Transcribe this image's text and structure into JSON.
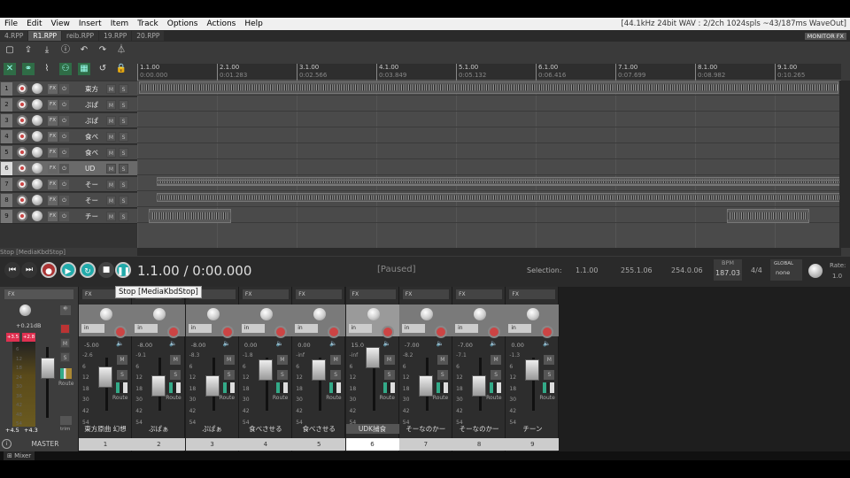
{
  "menu": {
    "items": [
      "File",
      "Edit",
      "View",
      "Insert",
      "Item",
      "Track",
      "Options",
      "Actions",
      "Help"
    ],
    "info": "[44.1kHz 24bit WAV : 2/2ch 1024spls ~43/187ms WaveOut]"
  },
  "tabs": [
    "4.RPP",
    "R1.RPP",
    "reib.RPP",
    "19.RPP",
    "20.RPP"
  ],
  "monitor_fx": "MONITOR FX",
  "tracks": [
    {
      "num": "1",
      "name": "東方",
      "sel": false
    },
    {
      "num": "2",
      "name": "ぷぱ",
      "sel": false
    },
    {
      "num": "3",
      "name": "ぷぱ",
      "sel": false
    },
    {
      "num": "4",
      "name": "食ベ",
      "sel": false
    },
    {
      "num": "5",
      "name": "食ベ",
      "sel": false
    },
    {
      "num": "6",
      "name": "UD",
      "sel": true
    },
    {
      "num": "7",
      "name": "そー",
      "sel": false
    },
    {
      "num": "8",
      "name": "そー",
      "sel": false
    },
    {
      "num": "9",
      "name": "チー",
      "sel": false
    }
  ],
  "ruler": [
    {
      "bar": "1.1.00",
      "time": "0:00.000"
    },
    {
      "bar": "2.1.00",
      "time": "0:01.283"
    },
    {
      "bar": "3.1.00",
      "time": "0:02.566"
    },
    {
      "bar": "4.1.00",
      "time": "0:03.849"
    },
    {
      "bar": "5.1.00",
      "time": "0:05.132"
    },
    {
      "bar": "6.1.00",
      "time": "0:06.416"
    },
    {
      "bar": "7.1.00",
      "time": "0:07.699"
    },
    {
      "bar": "8.1.00",
      "time": "0:08.982"
    },
    {
      "bar": "9.1.00",
      "time": "0:10.265"
    }
  ],
  "transport": {
    "stop_label": "Stop [MediaKbdStop]",
    "position": "1.1.00 / 0:00.000",
    "state": "[Paused]",
    "selection_label": "Selection:",
    "sel_start": "1.1.00",
    "sel_end": "255.1.06",
    "sel_len": "254.0.06",
    "bpm_label": "BPM",
    "bpm": "187.03",
    "timesig": "4/4",
    "global_label": "GLOBAL",
    "global_value": "none",
    "rate_label": "Rate:",
    "rate": "1.0"
  },
  "tooltip": "Stop [MediaKbdStop]",
  "master": {
    "label": "MASTER",
    "fx": "FX",
    "peak_l": "+3.5",
    "peak_r": "+2.8",
    "vol": "+0.21dB",
    "hold_l": "+4.5",
    "hold_r": "+4.3",
    "route": "Route",
    "trim": "trim",
    "scale": [
      "6",
      "12",
      "18",
      "24",
      "30",
      "36",
      "42",
      "48",
      "54"
    ]
  },
  "strips": [
    {
      "name": "東方原曲 幻想",
      "num": "1",
      "vol": "-5.00",
      "pan": "-2.6",
      "sel": false
    },
    {
      "name": "ぷぱぁ",
      "num": "2",
      "vol": "-8.00",
      "pan": "-9.1",
      "sel": false
    },
    {
      "name": "ぷぱぁ",
      "num": "3",
      "vol": "-8.00",
      "pan": "-8.3",
      "sel": false
    },
    {
      "name": "食べさせる",
      "num": "4",
      "vol": "0.00",
      "pan": "-1.8",
      "sel": false
    },
    {
      "name": "食べさせる",
      "num": "5",
      "vol": "0.00",
      "pan": "-inf",
      "sel": false
    },
    {
      "name": "UDK捕食",
      "num": "6",
      "vol": "15.0",
      "pan": "-inf",
      "sel": true
    },
    {
      "name": "そーなのかー",
      "num": "7",
      "vol": "-7.00",
      "pan": "-8.2",
      "sel": false
    },
    {
      "name": "そーなのかー",
      "num": "8",
      "vol": "-7.00",
      "pan": "-7.1",
      "sel": false
    },
    {
      "name": "チーン",
      "num": "9",
      "vol": "0.00",
      "pan": "-1.3",
      "sel": false
    }
  ],
  "strip_labels": {
    "fx": "FX",
    "in": "in",
    "m": "M",
    "s": "S",
    "route": "Route",
    "scale": [
      "6",
      "12",
      "18",
      "30",
      "42",
      "54"
    ]
  },
  "mixer_tab": "Mixer"
}
